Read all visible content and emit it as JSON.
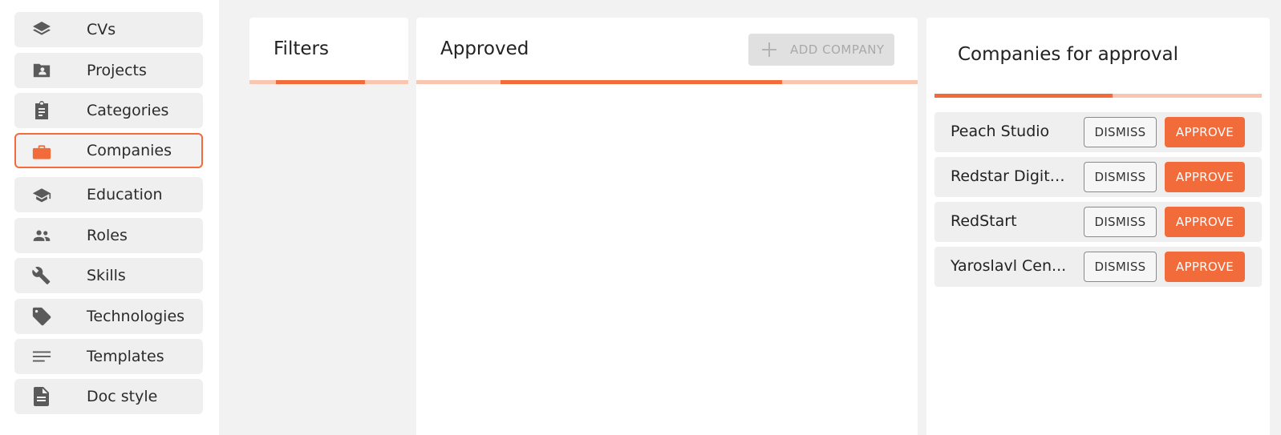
{
  "sidebar": {
    "items": [
      {
        "label": "CVs",
        "icon": "layers-icon"
      },
      {
        "label": "Projects",
        "icon": "folder-person-icon"
      },
      {
        "label": "Categories",
        "icon": "clipboard-icon"
      },
      {
        "label": "Companies",
        "icon": "briefcase-icon",
        "active": true
      },
      {
        "label": "Education",
        "icon": "graduation-cap-icon"
      },
      {
        "label": "Roles",
        "icon": "people-icon"
      },
      {
        "label": "Skills",
        "icon": "wrench-icon"
      },
      {
        "label": "Technologies",
        "icon": "tag-icon"
      },
      {
        "label": "Templates",
        "icon": "lines-icon"
      },
      {
        "label": "Doc style",
        "icon": "document-icon"
      }
    ]
  },
  "filters": {
    "title": "Filters"
  },
  "approved": {
    "title": "Approved",
    "add_button_label": "ADD COMPANY",
    "add_button_disabled": true
  },
  "approval": {
    "title": "Companies for approval",
    "dismiss_label": "DISMISS",
    "approve_label": "APPROVE",
    "companies": [
      {
        "name": "Peach Studio"
      },
      {
        "name": "Redstar Digita..."
      },
      {
        "name": "RedStart"
      },
      {
        "name": "Yaroslavl Cen..."
      }
    ]
  },
  "colors": {
    "accent": "#f26b3a",
    "accent_light": "#f8c6b1",
    "icon": "#5a5a5a"
  }
}
